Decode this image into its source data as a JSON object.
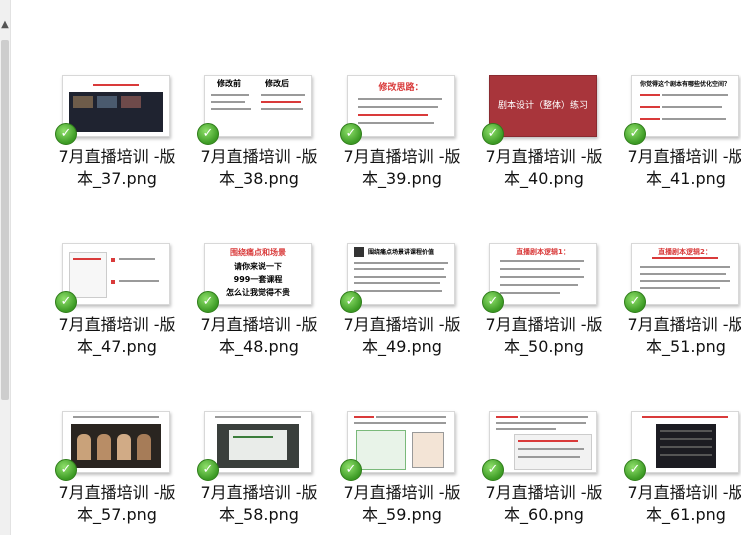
{
  "files": [
    {
      "name": "7月直播培训 -版本_37.png",
      "line1": "7月直播培训 -版",
      "line2": "本_37.png"
    },
    {
      "name": "7月直播培训 -版本_38.png",
      "line1": "7月直播培训 -版",
      "line2": "本_38.png"
    },
    {
      "name": "7月直播培训 -版本_39.png",
      "line1": "7月直播培训 -版",
      "line2": "本_39.png"
    },
    {
      "name": "7月直播培训 -版本_40.png",
      "line1": "7月直播培训 -版",
      "line2": "本_40.png"
    },
    {
      "name": "7月直播培训 -版本_41.png",
      "line1": "7月直播培训 -版",
      "line2": "本_41.png"
    },
    {
      "name": "7月直播培训 -版本_47.png",
      "line1": "7月直播培训 -版",
      "line2": "本_47.png"
    },
    {
      "name": "7月直播培训 -版本_48.png",
      "line1": "7月直播培训 -版",
      "line2": "本_48.png"
    },
    {
      "name": "7月直播培训 -版本_49.png",
      "line1": "7月直播培训 -版",
      "line2": "本_49.png"
    },
    {
      "name": "7月直播培训 -版本_50.png",
      "line1": "7月直播培训 -版",
      "line2": "本_50.png"
    },
    {
      "name": "7月直播培训 -版本_51.png",
      "line1": "7月直播培训 -版",
      "line2": "本_51.png"
    },
    {
      "name": "7月直播培训 -版本_57.png",
      "line1": "7月直播培训 -版",
      "line2": "本_57.png"
    },
    {
      "name": "7月直播培训 -版本_58.png",
      "line1": "7月直播培训 -版",
      "line2": "本_58.png"
    },
    {
      "name": "7月直播培训 -版本_59.png",
      "line1": "7月直播培训 -版",
      "line2": "本_59.png"
    },
    {
      "name": "7月直播培训 -版本_60.png",
      "line1": "7月直播培训 -版",
      "line2": "本_60.png"
    },
    {
      "name": "7月直播培训 -版本_61.png",
      "line1": "7月直播培训 -版",
      "line2": "本_61.png"
    }
  ],
  "thumb_text": {
    "t38_left": "修改前",
    "t38_right": "修改后",
    "t39": "修改思路：",
    "t40": "剧本设计（整体）练习",
    "t41": "你觉得这个剧本有哪些优化空间？",
    "t48_a": "围绕痛点和场景",
    "t48_b": "请你来说一下",
    "t48_c": "999一套课程",
    "t48_d": "怎么让我觉得不贵",
    "t49": "围绕痛点场景讲课程价值",
    "t50": "直播剧本逻辑1：",
    "t51": "直播剧本逻辑2："
  },
  "sync_status": "synced",
  "colors": {
    "check": "#3c9a24",
    "accent_red": "#c0392b",
    "slide_red": "#a8353b"
  }
}
